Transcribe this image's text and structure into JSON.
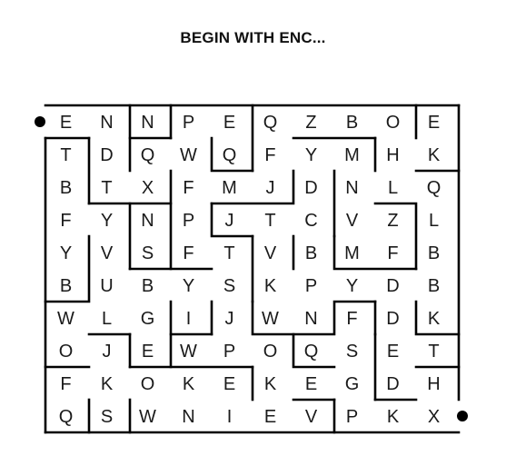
{
  "puzzle": {
    "title": "BEGIN WITH ENC...",
    "grid": [
      [
        "E",
        "N",
        "N",
        "P",
        "E",
        "Q",
        "Z",
        "B",
        "O",
        "E"
      ],
      [
        "T",
        "D",
        "Q",
        "W",
        "Q",
        "F",
        "Y",
        "M",
        "H",
        "K"
      ],
      [
        "B",
        "T",
        "X",
        "F",
        "M",
        "J",
        "D",
        "N",
        "L",
        "Q"
      ],
      [
        "F",
        "Y",
        "N",
        "P",
        "J",
        "T",
        "C",
        "V",
        "Z",
        "L"
      ],
      [
        "Y",
        "V",
        "S",
        "F",
        "T",
        "V",
        "B",
        "M",
        "F",
        "B"
      ],
      [
        "B",
        "U",
        "B",
        "Y",
        "S",
        "K",
        "P",
        "Y",
        "D",
        "B"
      ],
      [
        "W",
        "L",
        "G",
        "I",
        "J",
        "W",
        "N",
        "F",
        "D",
        "K"
      ],
      [
        "O",
        "J",
        "E",
        "W",
        "P",
        "O",
        "Q",
        "S",
        "E",
        "T"
      ],
      [
        "F",
        "K",
        "O",
        "K",
        "E",
        "K",
        "E",
        "G",
        "D",
        "H"
      ],
      [
        "Q",
        "S",
        "W",
        "N",
        "I",
        "E",
        "V",
        "P",
        "K",
        "X"
      ]
    ],
    "start_marker": "filled-dot",
    "end_marker": "filled-dot"
  }
}
